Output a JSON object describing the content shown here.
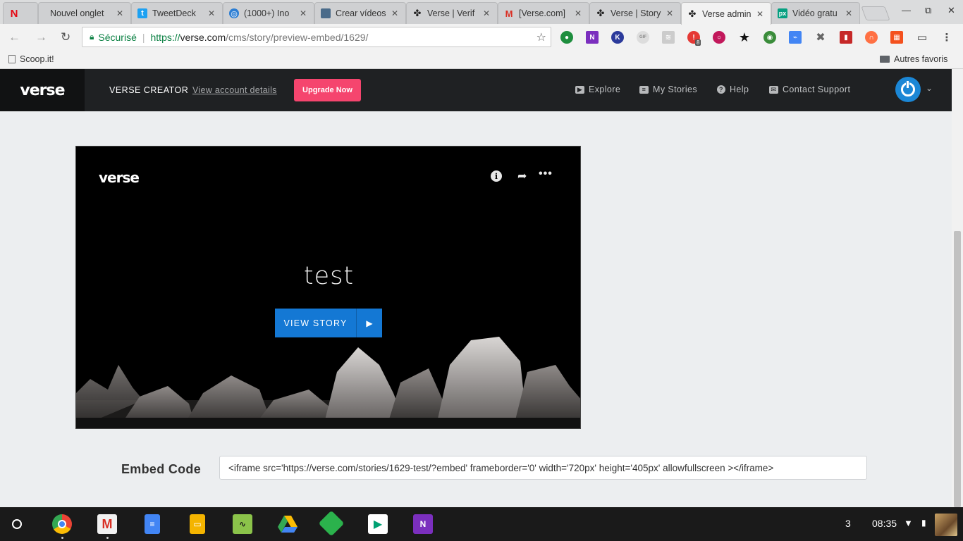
{
  "browser": {
    "tabs": [
      {
        "title": "",
        "icon": "netflix-icon",
        "color": "#e50914"
      },
      {
        "title": "Nouvel onglet",
        "icon": "new-tab-icon",
        "color": ""
      },
      {
        "title": "TweetDeck",
        "icon": "tweetdeck-icon",
        "color": "#1da1f2"
      },
      {
        "title": "(1000+) Ino",
        "icon": "inoreader-icon",
        "color": "#2b7dd3"
      },
      {
        "title": "Crear vídeos",
        "icon": "page-icon",
        "color": "#4a6b8a"
      },
      {
        "title": "Verse | Verif",
        "icon": "verse-icon",
        "color": ""
      },
      {
        "title": "[Verse.com]",
        "icon": "gmail-icon",
        "color": "#d93025"
      },
      {
        "title": "Verse | Story",
        "icon": "verse-icon",
        "color": ""
      },
      {
        "title": "Verse admin",
        "icon": "verse-icon",
        "color": ""
      },
      {
        "title": "Vidéo gratu",
        "icon": "pexels-icon",
        "color": "#05a081"
      }
    ],
    "secure_label": "Sécurisé",
    "url_scheme": "https://",
    "url_host": "verse.com",
    "url_path": "/cms/story/preview-embed/1629/",
    "bookmarks": [
      {
        "label": "Scoop.it!"
      }
    ],
    "other_bookmarks": "Autres favoris",
    "extension_badge": "8"
  },
  "verse": {
    "logo": "verse",
    "creator_label": "VERSE CREATOR",
    "account_link": "View account details",
    "upgrade_label": "Upgrade Now",
    "nav": {
      "explore": "Explore",
      "stories": "My Stories",
      "help": "Help",
      "support": "Contact Support"
    }
  },
  "preview": {
    "logo": "verse",
    "title": "test",
    "view_story": "VIEW STORY"
  },
  "embed": {
    "label": "Embed Code",
    "code": "<iframe src='https://verse.com/stories/1629-test/?embed' frameborder='0' width='720px' height='405px' allowfullscreen ></iframe>"
  },
  "shelf": {
    "notification_count": "3",
    "time": "08:35"
  },
  "colors": {
    "brand_pink": "#f5456e",
    "brand_blue": "#1478d4",
    "header_bg": "#1f2123"
  }
}
